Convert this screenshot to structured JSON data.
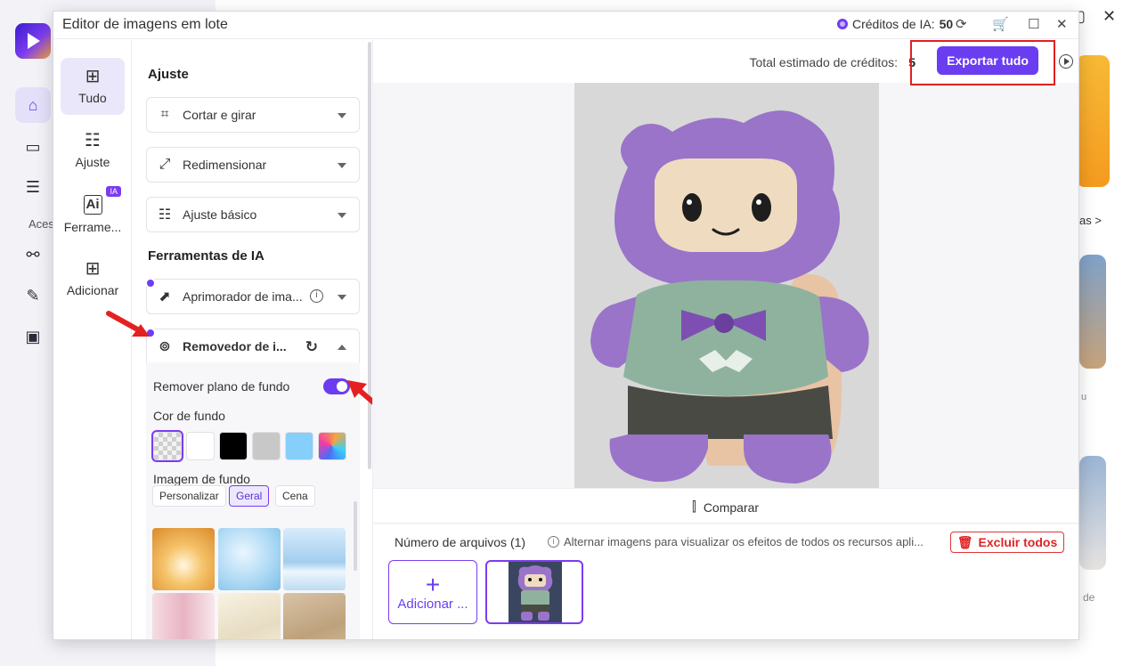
{
  "background": {
    "nav_icons": [
      "home-icon",
      "toolbox-icon",
      "document-icon",
      "link-icon",
      "edit-icon",
      "media-icon"
    ],
    "section_label": "Aces",
    "link_text": "as >",
    "snippet_1": "u",
    "snippet_2": "de"
  },
  "dialog": {
    "title": "Editor de imagens em lote",
    "credits_label": "Créditos de IA:",
    "credits_value": "50"
  },
  "rail": {
    "items": [
      {
        "label": "Tudo",
        "icon": "grid-icon"
      },
      {
        "label": "Ajuste",
        "icon": "sliders-icon"
      },
      {
        "label": "Ferrame...",
        "icon": "ai-tools-icon",
        "badge": "IA"
      },
      {
        "label": "Adicionar",
        "icon": "plus-square-icon"
      }
    ]
  },
  "panel": {
    "section_adjust": "Ajuste",
    "tools_adjust": [
      {
        "label": "Cortar e girar",
        "icon": "crop-rotate-icon"
      },
      {
        "label": "Redimensionar",
        "icon": "resize-icon"
      },
      {
        "label": "Ajuste básico",
        "icon": "sliders-icon"
      }
    ],
    "section_ai": "Ferramentas de IA",
    "tool_enhancer": "Aprimorador de ima...",
    "tool_remover": "Removedor de i...",
    "remove_bg_label": "Remover plano de fundo",
    "remove_bg_on": true,
    "bg_color_label": "Cor de fundo",
    "bg_colors": [
      "transparent",
      "#ffffff",
      "#000000",
      "#c8c8c8",
      "#86cffb",
      "gradient"
    ],
    "bg_image_label": "Imagem de fundo",
    "bg_image_tabs": [
      "Personalizar",
      "Geral",
      "Cena"
    ],
    "bg_image_active_tab": "Geral"
  },
  "preview": {
    "estimate_label": "Total estimado de créditos:",
    "estimate_value": "5",
    "export_label": "Exportar tudo",
    "compare_label": "Comparar",
    "files_count": "Número de arquivos (1)",
    "hint": "Alternar imagens para visualizar os efeitos de todos os recursos apli...",
    "delete_all": "Excluir todos",
    "add_label": "Adicionar ..."
  },
  "colors": {
    "accent": "#6a3df0",
    "danger": "#e02323"
  }
}
